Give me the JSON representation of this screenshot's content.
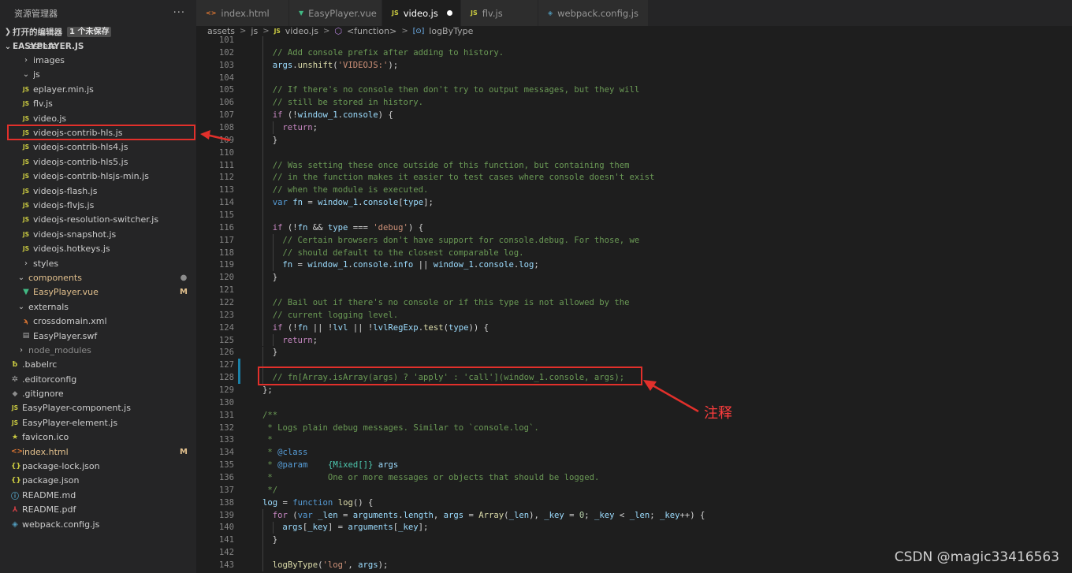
{
  "sidebar": {
    "title": "资源管理器",
    "more": "···",
    "open_editors": "打开的编辑器",
    "unsaved_badge": "1 个未保存",
    "project": "EASYPLAYER.JS",
    "tree": [
      {
        "label": "assets",
        "kind": "folder-open",
        "depth": 1
      },
      {
        "label": "images",
        "kind": "folder",
        "depth": 2
      },
      {
        "label": "js",
        "kind": "folder-open",
        "depth": 2
      },
      {
        "label": "eplayer.min.js",
        "kind": "js",
        "depth": 3
      },
      {
        "label": "flv.js",
        "kind": "js",
        "depth": 3
      },
      {
        "label": "video.js",
        "kind": "js",
        "depth": 3,
        "highlight": true
      },
      {
        "label": "videojs-contrib-hls.js",
        "kind": "js",
        "depth": 3
      },
      {
        "label": "videojs-contrib-hls4.js",
        "kind": "js",
        "depth": 3
      },
      {
        "label": "videojs-contrib-hls5.js",
        "kind": "js",
        "depth": 3
      },
      {
        "label": "videojs-contrib-hlsjs-min.js",
        "kind": "js",
        "depth": 3
      },
      {
        "label": "videojs-flash.js",
        "kind": "js",
        "depth": 3
      },
      {
        "label": "videojs-flvjs.js",
        "kind": "js",
        "depth": 3
      },
      {
        "label": "videojs-resolution-switcher.js",
        "kind": "js",
        "depth": 3
      },
      {
        "label": "videojs-snapshot.js",
        "kind": "js",
        "depth": 3
      },
      {
        "label": "videojs.hotkeys.js",
        "kind": "js",
        "depth": 3
      },
      {
        "label": "styles",
        "kind": "folder",
        "depth": 2
      },
      {
        "label": "components",
        "kind": "folder-open",
        "depth": 1,
        "status": "●",
        "modified": true
      },
      {
        "label": "EasyPlayer.vue",
        "kind": "vue",
        "depth": 2,
        "status": "M",
        "modified": true
      },
      {
        "label": "externals",
        "kind": "folder-open",
        "depth": 1
      },
      {
        "label": "crossdomain.xml",
        "kind": "xml",
        "depth": 2
      },
      {
        "label": "EasyPlayer.swf",
        "kind": "swf",
        "depth": 2
      },
      {
        "label": "node_modules",
        "kind": "folder",
        "depth": 1,
        "dim": true
      },
      {
        "label": ".babelrc",
        "kind": "babel",
        "depth": 0
      },
      {
        "label": ".editorconfig",
        "kind": "gear",
        "depth": 0
      },
      {
        "label": ".gitignore",
        "kind": "git",
        "depth": 0
      },
      {
        "label": "EasyPlayer-component.js",
        "kind": "js",
        "depth": 0
      },
      {
        "label": "EasyPlayer-element.js",
        "kind": "js",
        "depth": 0
      },
      {
        "label": "favicon.ico",
        "kind": "star",
        "depth": 0
      },
      {
        "label": "index.html",
        "kind": "html",
        "depth": 0,
        "status": "M",
        "modified": true
      },
      {
        "label": "package-lock.json",
        "kind": "json",
        "depth": 0
      },
      {
        "label": "package.json",
        "kind": "json",
        "depth": 0
      },
      {
        "label": "README.md",
        "kind": "info",
        "depth": 0
      },
      {
        "label": "README.pdf",
        "kind": "pdf",
        "depth": 0
      },
      {
        "label": "webpack.config.js",
        "kind": "wp",
        "depth": 0
      }
    ]
  },
  "tabs": [
    {
      "label": "index.html",
      "icon": "<>",
      "kind": "html",
      "width": 118
    },
    {
      "label": "EasyPlayer.vue",
      "icon": "▼",
      "kind": "vue",
      "width": 118
    },
    {
      "label": "video.js",
      "icon": "JS",
      "kind": "js",
      "width": 100,
      "active": true,
      "dirty": true
    },
    {
      "label": "flv.js",
      "icon": "JS",
      "kind": "js",
      "width": 98
    },
    {
      "label": "webpack.config.js",
      "icon": "◈",
      "kind": "wp",
      "width": 140
    }
  ],
  "breadcrumb": {
    "parts": [
      "assets",
      "js",
      "video.js",
      "<function>",
      "logByType"
    ],
    "separator": ">"
  },
  "editor": {
    "lines": [
      {
        "n": 101,
        "i": 1,
        "t": []
      },
      {
        "n": 102,
        "i": 1,
        "t": [
          [
            "c",
            "// Add console prefix after adding to history."
          ]
        ]
      },
      {
        "n": 103,
        "i": 1,
        "t": [
          [
            "v",
            "args"
          ],
          [
            "p",
            "."
          ],
          [
            "f",
            "unshift"
          ],
          [
            "p",
            "("
          ],
          [
            "s",
            "'VIDEOJS:'"
          ],
          [
            "p",
            ");"
          ]
        ]
      },
      {
        "n": 104,
        "i": 1,
        "t": []
      },
      {
        "n": 105,
        "i": 1,
        "t": [
          [
            "c",
            "// If there's no console then don't try to output messages, but they will"
          ]
        ]
      },
      {
        "n": 106,
        "i": 1,
        "t": [
          [
            "c",
            "// still be stored in history."
          ]
        ]
      },
      {
        "n": 107,
        "i": 1,
        "t": [
          [
            "kc",
            "if"
          ],
          [
            "p",
            " (!"
          ],
          [
            "v",
            "window_1"
          ],
          [
            "p",
            "."
          ],
          [
            "v",
            "console"
          ],
          [
            "p",
            ") {"
          ]
        ]
      },
      {
        "n": 108,
        "i": 2,
        "t": [
          [
            "kc",
            "return"
          ],
          [
            "p",
            ";"
          ]
        ]
      },
      {
        "n": 109,
        "i": 1,
        "t": [
          [
            "p",
            "}"
          ]
        ]
      },
      {
        "n": 110,
        "i": 1,
        "t": []
      },
      {
        "n": 111,
        "i": 1,
        "t": [
          [
            "c",
            "// Was setting these once outside of this function, but containing them"
          ]
        ]
      },
      {
        "n": 112,
        "i": 1,
        "t": [
          [
            "c",
            "// in the function makes it easier to test cases where console doesn't exist"
          ]
        ]
      },
      {
        "n": 113,
        "i": 1,
        "t": [
          [
            "c",
            "// when the module is executed."
          ]
        ]
      },
      {
        "n": 114,
        "i": 1,
        "t": [
          [
            "k",
            "var"
          ],
          [
            "p",
            " "
          ],
          [
            "v",
            "fn"
          ],
          [
            "p",
            " = "
          ],
          [
            "v",
            "window_1"
          ],
          [
            "p",
            "."
          ],
          [
            "v",
            "console"
          ],
          [
            "p",
            "["
          ],
          [
            "v",
            "type"
          ],
          [
            "p",
            "];"
          ]
        ]
      },
      {
        "n": 115,
        "i": 1,
        "t": []
      },
      {
        "n": 116,
        "i": 1,
        "t": [
          [
            "kc",
            "if"
          ],
          [
            "p",
            " (!"
          ],
          [
            "v",
            "fn"
          ],
          [
            "p",
            " && "
          ],
          [
            "v",
            "type"
          ],
          [
            "p",
            " === "
          ],
          [
            "s",
            "'debug'"
          ],
          [
            "p",
            ") {"
          ]
        ]
      },
      {
        "n": 117,
        "i": 2,
        "t": [
          [
            "c",
            "// Certain browsers don't have support for console.debug. For those, we"
          ]
        ]
      },
      {
        "n": 118,
        "i": 2,
        "t": [
          [
            "c",
            "// should default to the closest comparable log."
          ]
        ]
      },
      {
        "n": 119,
        "i": 2,
        "t": [
          [
            "v",
            "fn"
          ],
          [
            "p",
            " = "
          ],
          [
            "v",
            "window_1"
          ],
          [
            "p",
            "."
          ],
          [
            "v",
            "console"
          ],
          [
            "p",
            "."
          ],
          [
            "v",
            "info"
          ],
          [
            "p",
            " || "
          ],
          [
            "v",
            "window_1"
          ],
          [
            "p",
            "."
          ],
          [
            "v",
            "console"
          ],
          [
            "p",
            "."
          ],
          [
            "v",
            "log"
          ],
          [
            "p",
            ";"
          ]
        ]
      },
      {
        "n": 120,
        "i": 1,
        "t": [
          [
            "p",
            "}"
          ]
        ]
      },
      {
        "n": 121,
        "i": 1,
        "t": []
      },
      {
        "n": 122,
        "i": 1,
        "t": [
          [
            "c",
            "// Bail out if there's no console or if this type is not allowed by the"
          ]
        ]
      },
      {
        "n": 123,
        "i": 1,
        "t": [
          [
            "c",
            "// current logging level."
          ]
        ]
      },
      {
        "n": 124,
        "i": 1,
        "t": [
          [
            "kc",
            "if"
          ],
          [
            "p",
            " (!"
          ],
          [
            "v",
            "fn"
          ],
          [
            "p",
            " || !"
          ],
          [
            "v",
            "lvl"
          ],
          [
            "p",
            " || !"
          ],
          [
            "v",
            "lvlRegExp"
          ],
          [
            "p",
            "."
          ],
          [
            "f",
            "test"
          ],
          [
            "p",
            "("
          ],
          [
            "v",
            "type"
          ],
          [
            "p",
            ")) {"
          ]
        ]
      },
      {
        "n": 125,
        "i": 2,
        "t": [
          [
            "kc",
            "return"
          ],
          [
            "p",
            ";"
          ]
        ]
      },
      {
        "n": 126,
        "i": 1,
        "t": [
          [
            "p",
            "}"
          ]
        ]
      },
      {
        "n": 127,
        "i": 1,
        "t": [],
        "mod": true
      },
      {
        "n": 128,
        "i": 1,
        "t": [
          [
            "c",
            "// fn[Array.isArray(args) ? 'apply' : 'call'](window_1.console, args);"
          ]
        ],
        "mod": true
      },
      {
        "n": 129,
        "i": 0,
        "t": [
          [
            "p",
            "};"
          ]
        ]
      },
      {
        "n": 130,
        "i": 0,
        "t": []
      },
      {
        "n": 131,
        "i": 0,
        "t": [
          [
            "c",
            "/**"
          ]
        ]
      },
      {
        "n": 132,
        "i": 0,
        "t": [
          [
            "c",
            " * Logs plain debug messages. Similar to `console.log`."
          ]
        ]
      },
      {
        "n": 133,
        "i": 0,
        "t": [
          [
            "c",
            " *"
          ]
        ]
      },
      {
        "n": 134,
        "i": 0,
        "t": [
          [
            "c",
            " * "
          ],
          [
            "k",
            "@class"
          ]
        ]
      },
      {
        "n": 135,
        "i": 0,
        "t": [
          [
            "c",
            " * "
          ],
          [
            "k",
            "@param"
          ],
          [
            "c",
            "    "
          ],
          [
            "t",
            "{Mixed[]}"
          ],
          [
            "c",
            " "
          ],
          [
            "v",
            "args"
          ]
        ]
      },
      {
        "n": 136,
        "i": 0,
        "t": [
          [
            "c",
            " *           One or more messages or objects that should be logged."
          ]
        ]
      },
      {
        "n": 137,
        "i": 0,
        "t": [
          [
            "c",
            " */"
          ]
        ]
      },
      {
        "n": 138,
        "i": 0,
        "t": [
          [
            "v",
            "log"
          ],
          [
            "p",
            " = "
          ],
          [
            "k",
            "function"
          ],
          [
            "p",
            " "
          ],
          [
            "f",
            "log"
          ],
          [
            "p",
            "() {"
          ]
        ]
      },
      {
        "n": 139,
        "i": 1,
        "t": [
          [
            "kc",
            "for"
          ],
          [
            "p",
            " ("
          ],
          [
            "k",
            "var"
          ],
          [
            "p",
            " "
          ],
          [
            "v",
            "_len"
          ],
          [
            "p",
            " = "
          ],
          [
            "v",
            "arguments"
          ],
          [
            "p",
            "."
          ],
          [
            "v",
            "length"
          ],
          [
            "p",
            ", "
          ],
          [
            "v",
            "args"
          ],
          [
            "p",
            " = "
          ],
          [
            "f",
            "Array"
          ],
          [
            "p",
            "("
          ],
          [
            "v",
            "_len"
          ],
          [
            "p",
            "), "
          ],
          [
            "v",
            "_key"
          ],
          [
            "p",
            " = "
          ],
          [
            "n",
            "0"
          ],
          [
            "p",
            "; "
          ],
          [
            "v",
            "_key"
          ],
          [
            "p",
            " < "
          ],
          [
            "v",
            "_len"
          ],
          [
            "p",
            "; "
          ],
          [
            "v",
            "_key"
          ],
          [
            "p",
            "++) {"
          ]
        ]
      },
      {
        "n": 140,
        "i": 2,
        "t": [
          [
            "v",
            "args"
          ],
          [
            "p",
            "["
          ],
          [
            "v",
            "_key"
          ],
          [
            "p",
            "] = "
          ],
          [
            "v",
            "arguments"
          ],
          [
            "p",
            "["
          ],
          [
            "v",
            "_key"
          ],
          [
            "p",
            "];"
          ]
        ]
      },
      {
        "n": 141,
        "i": 1,
        "t": [
          [
            "p",
            "}"
          ]
        ]
      },
      {
        "n": 142,
        "i": 1,
        "t": []
      },
      {
        "n": 143,
        "i": 1,
        "t": [
          [
            "f",
            "logByType"
          ],
          [
            "p",
            "("
          ],
          [
            "s",
            "'log'"
          ],
          [
            "p",
            ", "
          ],
          [
            "v",
            "args"
          ],
          [
            "p",
            ");"
          ]
        ]
      }
    ]
  },
  "annotation": {
    "text": "注释"
  },
  "watermark": "CSDN @magic33416563",
  "colors": {
    "annotation_red": "#e2302b",
    "accent_blue": "#1b81a8",
    "modified": "#e2c08d"
  }
}
